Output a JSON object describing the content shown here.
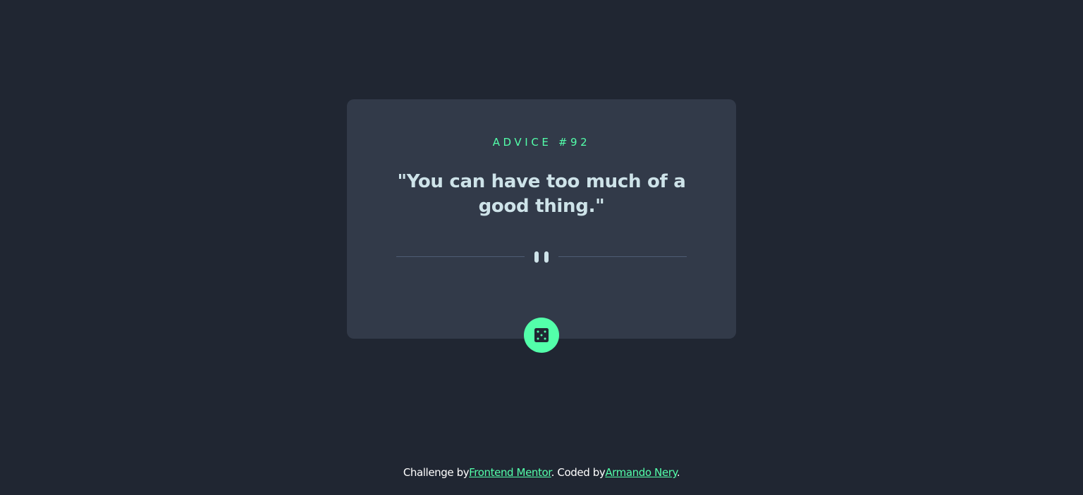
{
  "card": {
    "label": "ADVICE #92",
    "quote": "\"You can have too much of a good thing.\""
  },
  "divider": {
    "icon": "pause-icon"
  },
  "button": {
    "icon": "dice-icon"
  },
  "footer": {
    "prefix": "Challenge by",
    "link1": "Frontend Mentor",
    "middle": ". Coded by",
    "link2": "Armando Nery",
    "suffix": "."
  },
  "colors": {
    "background": "#202632",
    "card": "#323a49",
    "accent": "#53ffaa",
    "text": "#cee3e9",
    "divider": "#4f5d74"
  }
}
